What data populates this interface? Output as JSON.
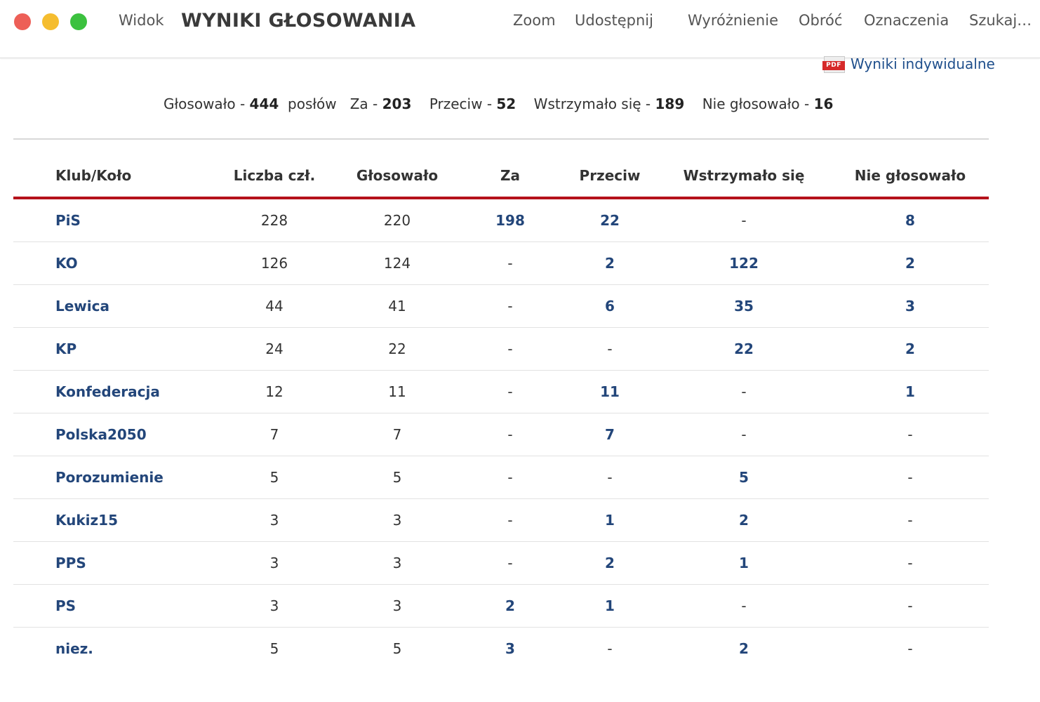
{
  "window": {
    "title": "WYNIKI GŁOSOWANIA",
    "menu": [
      "Widok",
      "Zoom",
      "Udostępnij",
      "Wyróżnienie",
      "Obróć",
      "Oznaczenia",
      "Szukaj…"
    ]
  },
  "pdf_link": {
    "label": "Wyniki indywidualne",
    "icon": "pdf-icon",
    "icon_text": "PDF"
  },
  "summary": {
    "voted_label": "Głosowało -",
    "voted": "444",
    "voted_unit": "posłów",
    "for_label": "Za -",
    "for": "203",
    "against_label": "Przeciw -",
    "against": "52",
    "abstained_label": "Wstrzymało się -",
    "abstained": "189",
    "not_voted_label": "Nie głosowało -",
    "not_voted": "16"
  },
  "table": {
    "headers": [
      "Klub/Koło",
      "Liczba czł.",
      "Głosowało",
      "Za",
      "Przeciw",
      "Wstrzymało się",
      "Nie głosowało"
    ],
    "rows": [
      [
        "PiS",
        "228",
        "220",
        "198",
        "22",
        "-",
        "8"
      ],
      [
        "KO",
        "126",
        "124",
        "-",
        "2",
        "122",
        "2"
      ],
      [
        "Lewica",
        "44",
        "41",
        "-",
        "6",
        "35",
        "3"
      ],
      [
        "KP",
        "24",
        "22",
        "-",
        "-",
        "22",
        "2"
      ],
      [
        "Konfederacja",
        "12",
        "11",
        "-",
        "11",
        "-",
        "1"
      ],
      [
        "Polska2050",
        "7",
        "7",
        "-",
        "7",
        "-",
        "-"
      ],
      [
        "Porozumienie",
        "5",
        "5",
        "-",
        "-",
        "5",
        "-"
      ],
      [
        "Kukiz15",
        "3",
        "3",
        "-",
        "1",
        "2",
        "-"
      ],
      [
        "PPS",
        "3",
        "3",
        "-",
        "2",
        "1",
        "-"
      ],
      [
        "PS",
        "3",
        "3",
        "2",
        "1",
        "-",
        "-"
      ],
      [
        "niez.",
        "5",
        "5",
        "3",
        "-",
        "2",
        "-"
      ]
    ]
  },
  "colors": {
    "link": "#23467a",
    "accent": "#b5121b"
  }
}
